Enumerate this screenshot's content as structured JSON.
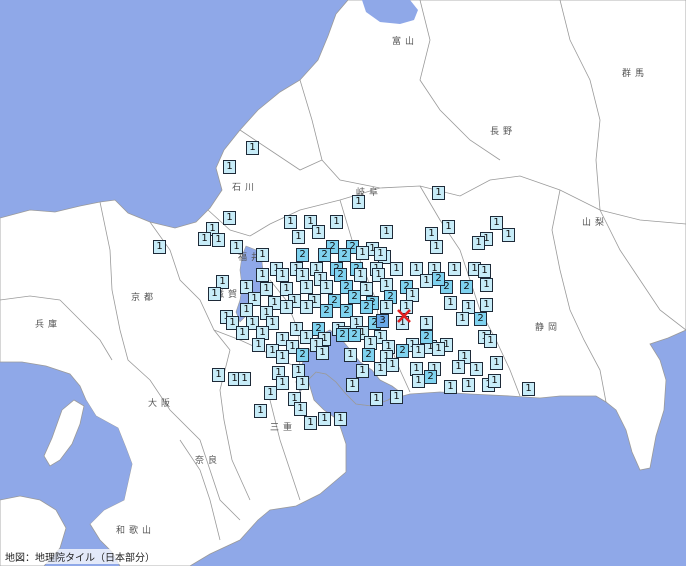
{
  "colors": {
    "sea": "#8fa8e8",
    "land": "#ffffff",
    "border": "#9a9a9a",
    "intensity_1": "#c7ecf8",
    "intensity_2": "#7fd2ef",
    "intensity_3": "#6aa8e8",
    "epicenter": "#e02020"
  },
  "map": {
    "attribution": "地図：地理院タイル（日本部分）",
    "prefecture_labels": [
      "富山",
      "群馬",
      "長野",
      "石川",
      "岐阜",
      "山梨",
      "福井",
      "京都",
      "兵庫",
      "滋賀",
      "静岡",
      "大阪",
      "三重",
      "奈良",
      "和歌山"
    ],
    "epicenter_icon": "x-mark-icon",
    "intensity_levels": [
      "1",
      "2",
      "3"
    ]
  }
}
